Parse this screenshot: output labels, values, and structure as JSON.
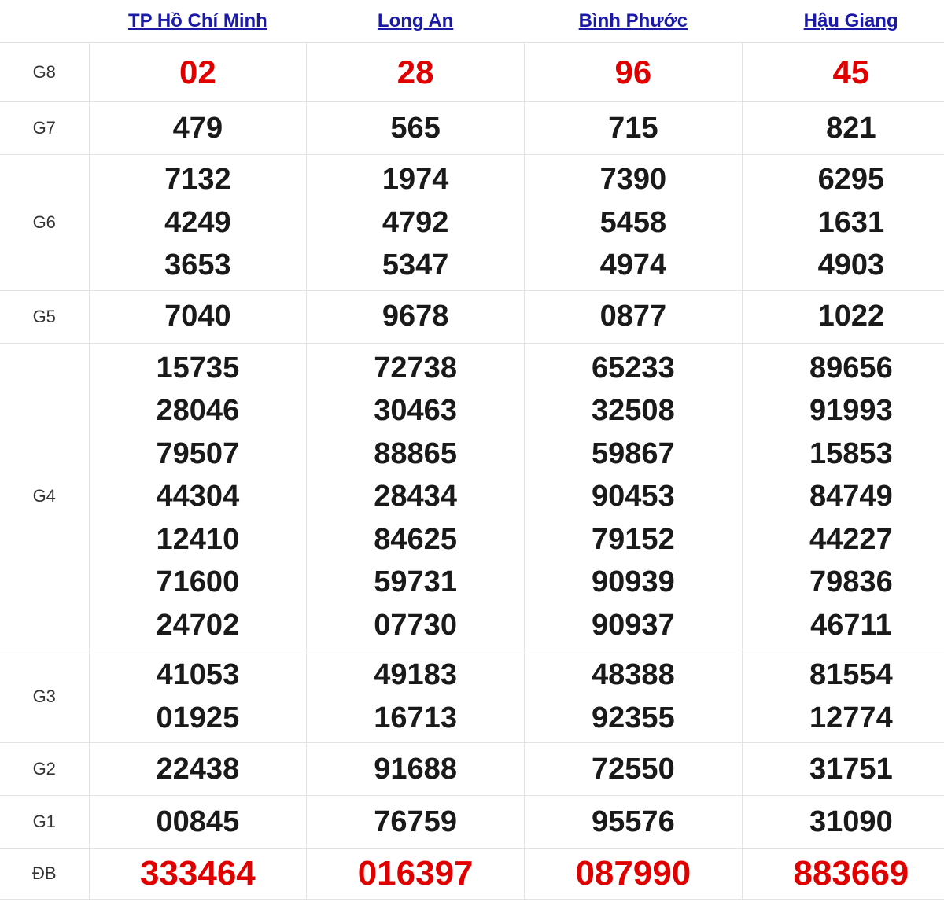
{
  "provinces": [
    "TP Hồ Chí Minh",
    "Long An",
    "Bình Phước",
    "Hậu Giang"
  ],
  "labels": {
    "g8": "G8",
    "g7": "G7",
    "g6": "G6",
    "g5": "G5",
    "g4": "G4",
    "g3": "G3",
    "g2": "G2",
    "g1": "G1",
    "db": "ĐB"
  },
  "results": {
    "g8": [
      [
        "02"
      ],
      [
        "28"
      ],
      [
        "96"
      ],
      [
        "45"
      ]
    ],
    "g7": [
      [
        "479"
      ],
      [
        "565"
      ],
      [
        "715"
      ],
      [
        "821"
      ]
    ],
    "g6": [
      [
        "7132",
        "4249",
        "3653"
      ],
      [
        "1974",
        "4792",
        "5347"
      ],
      [
        "7390",
        "5458",
        "4974"
      ],
      [
        "6295",
        "1631",
        "4903"
      ]
    ],
    "g5": [
      [
        "7040"
      ],
      [
        "9678"
      ],
      [
        "0877"
      ],
      [
        "1022"
      ]
    ],
    "g4": [
      [
        "15735",
        "28046",
        "79507",
        "44304",
        "12410",
        "71600",
        "24702"
      ],
      [
        "72738",
        "30463",
        "88865",
        "28434",
        "84625",
        "59731",
        "07730"
      ],
      [
        "65233",
        "32508",
        "59867",
        "90453",
        "79152",
        "90939",
        "90937"
      ],
      [
        "89656",
        "91993",
        "15853",
        "84749",
        "44227",
        "79836",
        "46711"
      ]
    ],
    "g3": [
      [
        "41053",
        "01925"
      ],
      [
        "49183",
        "16713"
      ],
      [
        "48388",
        "92355"
      ],
      [
        "81554",
        "12774"
      ]
    ],
    "g2": [
      [
        "22438"
      ],
      [
        "91688"
      ],
      [
        "72550"
      ],
      [
        "31751"
      ]
    ],
    "g1": [
      [
        "00845"
      ],
      [
        "76759"
      ],
      [
        "95576"
      ],
      [
        "31090"
      ]
    ],
    "db": [
      [
        "333464"
      ],
      [
        "016397"
      ],
      [
        "087990"
      ],
      [
        "883669"
      ]
    ]
  },
  "colors": {
    "header_link": "#1a1aa6",
    "highlight": "#e00000",
    "number": "#1a1a1a",
    "grid": "#e3e3e3"
  }
}
